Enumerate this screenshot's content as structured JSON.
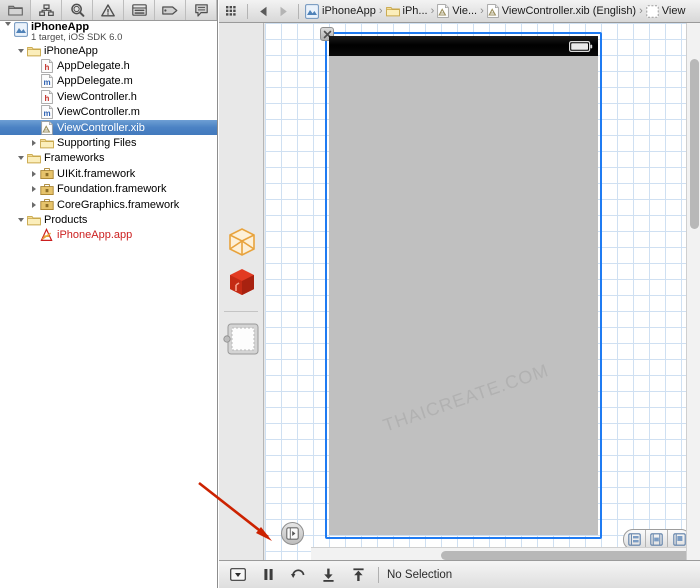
{
  "navigator": {
    "tabs": [
      {
        "name": "project-navigator",
        "icon": "folder-icon",
        "active": true
      },
      {
        "name": "symbol-navigator",
        "icon": "symbol-icon",
        "active": false
      },
      {
        "name": "search-navigator",
        "icon": "search-icon",
        "active": false
      },
      {
        "name": "issue-navigator",
        "icon": "warning-icon",
        "active": false
      },
      {
        "name": "test-navigator",
        "icon": "test-icon",
        "active": false
      },
      {
        "name": "debug-navigator",
        "icon": "debug-icon",
        "active": false
      },
      {
        "name": "log-navigator",
        "icon": "log-icon",
        "active": false
      }
    ],
    "tree": [
      {
        "label": "iPhoneApp",
        "sublabel": "1 target, iOS SDK 6.0",
        "icon": "xcode-project-icon",
        "indent": 0,
        "disclosure": "open",
        "type": "project",
        "selected": false
      },
      {
        "label": "iPhoneApp",
        "sublabel": "",
        "icon": "folder-icon",
        "indent": 1,
        "disclosure": "open",
        "type": "group",
        "selected": false
      },
      {
        "label": "AppDelegate.h",
        "sublabel": "",
        "icon": "header-file-icon",
        "indent": 2,
        "disclosure": "none",
        "type": "file",
        "selected": false
      },
      {
        "label": "AppDelegate.m",
        "sublabel": "",
        "icon": "source-file-icon",
        "indent": 2,
        "disclosure": "none",
        "type": "file",
        "selected": false
      },
      {
        "label": "ViewController.h",
        "sublabel": "",
        "icon": "header-file-icon",
        "indent": 2,
        "disclosure": "none",
        "type": "file",
        "selected": false
      },
      {
        "label": "ViewController.m",
        "sublabel": "",
        "icon": "source-file-icon",
        "indent": 2,
        "disclosure": "none",
        "type": "file",
        "selected": false
      },
      {
        "label": "ViewController.xib",
        "sublabel": "",
        "icon": "xib-file-icon",
        "indent": 2,
        "disclosure": "none",
        "type": "file",
        "selected": true
      },
      {
        "label": "Supporting Files",
        "sublabel": "",
        "icon": "folder-icon",
        "indent": 2,
        "disclosure": "closed",
        "type": "group",
        "selected": false
      },
      {
        "label": "Frameworks",
        "sublabel": "",
        "icon": "folder-icon",
        "indent": 1,
        "disclosure": "open",
        "type": "group",
        "selected": false
      },
      {
        "label": "UIKit.framework",
        "sublabel": "",
        "icon": "framework-icon",
        "indent": 2,
        "disclosure": "closed",
        "type": "framework",
        "selected": false
      },
      {
        "label": "Foundation.framework",
        "sublabel": "",
        "icon": "framework-icon",
        "indent": 2,
        "disclosure": "closed",
        "type": "framework",
        "selected": false
      },
      {
        "label": "CoreGraphics.framework",
        "sublabel": "",
        "icon": "framework-icon",
        "indent": 2,
        "disclosure": "closed",
        "type": "framework",
        "selected": false
      },
      {
        "label": "Products",
        "sublabel": "",
        "icon": "folder-icon",
        "indent": 1,
        "disclosure": "open",
        "type": "group",
        "selected": false
      },
      {
        "label": "iPhoneApp.app",
        "sublabel": "",
        "icon": "app-product-icon",
        "indent": 2,
        "disclosure": "none",
        "type": "product-missing",
        "selected": false
      }
    ]
  },
  "jumpbar": {
    "back_icon": "back-arrow-icon",
    "forward_icon": "forward-arrow-icon",
    "related_icon": "related-items-icon",
    "breadcrumbs": [
      {
        "label": "iPhoneApp",
        "icon": "xcode-project-icon"
      },
      {
        "label": "iPh...",
        "icon": "folder-icon"
      },
      {
        "label": "Vie...",
        "icon": "xib-file-icon"
      },
      {
        "label": "ViewController.xib (English)",
        "icon": "xib-file-icon"
      },
      {
        "label": "View",
        "icon": "view-object-icon"
      }
    ],
    "separator": "›"
  },
  "canvas": {
    "dock_items": [
      {
        "name": "files-owner",
        "icon": "wireframe-cube-icon"
      },
      {
        "name": "first-responder",
        "icon": "red-cube-icon"
      },
      {
        "name": "view-object",
        "icon": "view-placeholder-icon"
      }
    ],
    "watermark": "THAICREATE.COM",
    "close_badge_icon": "close-x-icon",
    "outline_button_icon": "show-document-outline-icon",
    "align_buttons": [
      {
        "name": "align-button",
        "icon": "align-left-icon"
      },
      {
        "name": "pin-button",
        "icon": "pin-icon"
      },
      {
        "name": "resolve-button",
        "icon": "resolve-issues-icon"
      }
    ],
    "status_bar_battery_icon": "battery-icon"
  },
  "bottombar": {
    "buttons": [
      {
        "name": "view-mode-button",
        "icon": "view-mode-icon"
      },
      {
        "name": "pause-button",
        "icon": "pause-icon"
      },
      {
        "name": "refresh-button",
        "icon": "refresh-icon"
      },
      {
        "name": "step-into-button",
        "icon": "step-into-icon"
      },
      {
        "name": "step-out-button",
        "icon": "step-out-icon"
      }
    ],
    "status_text": "No Selection"
  },
  "colors": {
    "selection_blue": "#4b82c4",
    "frame_blue": "#1f7bf2",
    "annotation_red": "#cc2200",
    "product_red": "#cc1f1f",
    "device_gray": "#c0c0c0"
  }
}
